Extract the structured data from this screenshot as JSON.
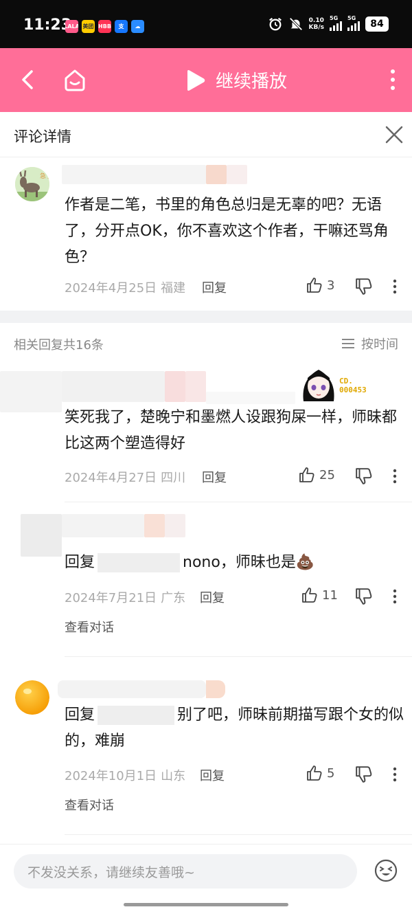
{
  "status_bar": {
    "time": "11:23",
    "app_icons": [
      "LALA",
      "美团",
      "HBB",
      "支",
      "☁"
    ],
    "net_speed_value": "0.10",
    "net_speed_unit": "KB/s",
    "signal_labels": [
      "5G",
      "5G"
    ],
    "battery": "84"
  },
  "header": {
    "title": "继续播放",
    "accent_color": "#ff6e98"
  },
  "detail": {
    "title": "评论详情"
  },
  "main_comment": {
    "text": "作者是二笔，书里的角色总归是无辜的吧？无语了，分开点OK，你不喜欢这个作者，干嘛还骂角色？",
    "date": "2024年4月25日",
    "location": "福建",
    "reply_label": "回复",
    "likes": "3"
  },
  "replies_header": {
    "count_text": "相关回复共16条",
    "sort_label": "按时间"
  },
  "replies": [
    {
      "text": "笑死我了，楚晚宁和墨燃人设跟狗屎一样，师昧都比这两个塑造得好",
      "badge": "CD.\n000453",
      "date": "2024年4月27日",
      "location": "四川",
      "reply_label": "回复",
      "likes": "25"
    },
    {
      "prefix": "回复",
      "text": "nono，师昧也是💩",
      "date": "2024年7月21日",
      "location": "广东",
      "reply_label": "回复",
      "likes": "11",
      "view_conv": "查看对话"
    },
    {
      "prefix": "回复",
      "text": "别了吧，师昧前期描写跟个女的似的，难崩",
      "date": "2024年10月1日",
      "location": "山东",
      "reply_label": "回复",
      "likes": "5",
      "view_conv": "查看对话"
    }
  ],
  "input": {
    "placeholder": "不发没关系，请继续友善哦~"
  }
}
